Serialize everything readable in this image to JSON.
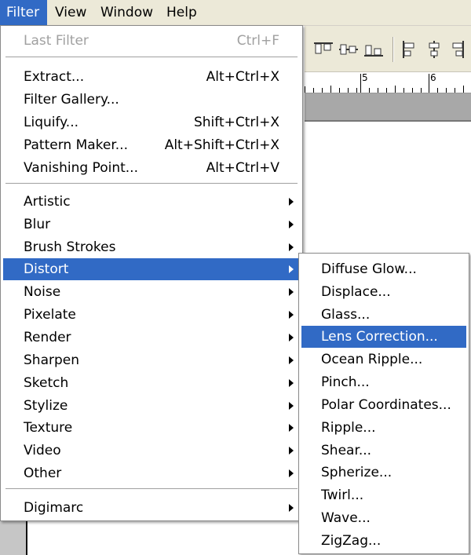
{
  "menubar": {
    "items": [
      "Filter",
      "View",
      "Window",
      "Help"
    ]
  },
  "toolbar": {
    "icons": [
      "align-top-edges-icon",
      "align-vertical-centers-icon",
      "align-bottom-edges-icon",
      "align-left-edges-icon",
      "align-horizontal-centers-icon",
      "align-right-edges-icon"
    ]
  },
  "ruler": {
    "labels": [
      "5",
      "6"
    ]
  },
  "filter_menu": {
    "last_filter": {
      "label": "Last Filter",
      "shortcut": "Ctrl+F"
    },
    "tools": [
      {
        "label": "Extract...",
        "shortcut": "Alt+Ctrl+X"
      },
      {
        "label": "Filter Gallery...",
        "shortcut": ""
      },
      {
        "label": "Liquify...",
        "shortcut": "Shift+Ctrl+X"
      },
      {
        "label": "Pattern Maker...",
        "shortcut": "Alt+Shift+Ctrl+X"
      },
      {
        "label": "Vanishing Point...",
        "shortcut": "Alt+Ctrl+V"
      }
    ],
    "categories": [
      "Artistic",
      "Blur",
      "Brush Strokes",
      "Distort",
      "Noise",
      "Pixelate",
      "Render",
      "Sharpen",
      "Sketch",
      "Stylize",
      "Texture",
      "Video",
      "Other"
    ],
    "plugins": [
      "Digimarc"
    ],
    "highlighted": "Distort"
  },
  "distort_submenu": {
    "items": [
      "Diffuse Glow...",
      "Displace...",
      "Glass...",
      "Lens Correction...",
      "Ocean Ripple...",
      "Pinch...",
      "Polar Coordinates...",
      "Ripple...",
      "Shear...",
      "Spherize...",
      "Twirl...",
      "Wave...",
      "ZigZag..."
    ],
    "highlighted": "Lens Correction..."
  },
  "colors": {
    "highlight": "#316ac5",
    "menubar_bg": "#ece9d8",
    "disabled_text": "#a0a0a0"
  }
}
